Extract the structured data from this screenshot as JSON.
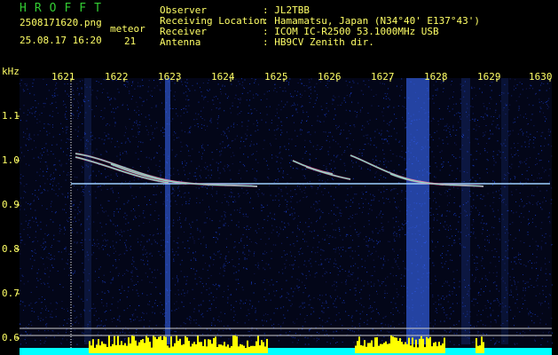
{
  "app": {
    "title": "HROFFT",
    "filename": "2508171620.png",
    "datetime": "25.08.17 16:20",
    "event_label": "meteor",
    "event_count": "21"
  },
  "station": {
    "observer_label": "Observer",
    "observer_value": ": JL2TBB",
    "location_label": "Receiving Location",
    "location_value": ": Hamamatsu, Japan (N34°40' E137°43')",
    "receiver_label": "Receiver",
    "receiver_value": ": ICOM IC-R2500 53.1000MHz USB",
    "antenna_label": "Antenna",
    "antenna_value": ": HB9CV Zenith dir."
  },
  "axes": {
    "y_unit": "kHz",
    "y_ticks": [
      "1.1",
      "1.0",
      "0.9",
      "0.8",
      "0.7",
      "0.6"
    ],
    "x_ticks": [
      "1621",
      "1622",
      "1623",
      "1624",
      "1625",
      "1626",
      "1627",
      "1628",
      "1629",
      "1630"
    ]
  },
  "colors": {
    "background": "#000000",
    "noise": "#2233aa",
    "text": "#ffff66",
    "title": "#33cc33",
    "signal": "#ffff00",
    "baseline": "#00ffff"
  }
}
